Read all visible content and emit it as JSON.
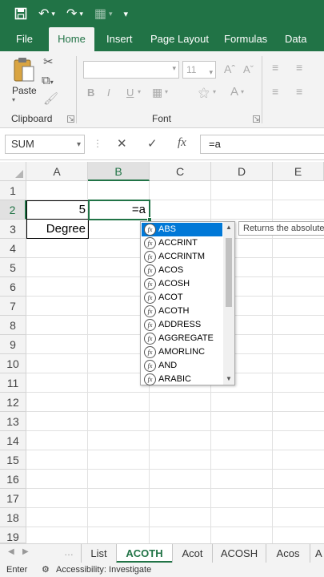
{
  "qat": {
    "save_icon": "save-icon",
    "undo_icon": "undo-icon",
    "redo_icon": "redo-icon",
    "form_icon": "form-icon",
    "customize_icon": "customize-qat-icon"
  },
  "tabs": [
    {
      "label": "File"
    },
    {
      "label": "Home"
    },
    {
      "label": "Insert"
    },
    {
      "label": "Page Layout"
    },
    {
      "label": "Formulas"
    },
    {
      "label": "Data"
    }
  ],
  "ribbon": {
    "paste_label": "Paste",
    "clipboard_label": "Clipboard",
    "font_label": "Font",
    "font_size": "11"
  },
  "formula_bar": {
    "name_box": "SUM",
    "fx_label": "fx",
    "formula": "=a"
  },
  "grid": {
    "columns": [
      "A",
      "B",
      "C",
      "D",
      "E"
    ],
    "rows": [
      "1",
      "2",
      "3",
      "4",
      "5",
      "6",
      "7",
      "8",
      "9",
      "10",
      "11",
      "12",
      "13",
      "14",
      "15",
      "16",
      "17",
      "18",
      "19"
    ],
    "a2": "5",
    "b2": "=a",
    "a3": "Degree"
  },
  "autocomplete": {
    "items": [
      "ABS",
      "ACCRINT",
      "ACCRINTM",
      "ACOS",
      "ACOSH",
      "ACOT",
      "ACOTH",
      "ADDRESS",
      "AGGREGATE",
      "AMORLINC",
      "AND",
      "ARABIC"
    ],
    "tooltip": "Returns the absolute value"
  },
  "sheets": [
    "List",
    "ACOTH",
    "Acot",
    "ACOSH",
    "Acos",
    "A"
  ],
  "status": {
    "mode": "Enter",
    "accessibility": "Accessibility: Investigate"
  },
  "colors": {
    "accent": "#217346",
    "selection": "#0078d7"
  }
}
